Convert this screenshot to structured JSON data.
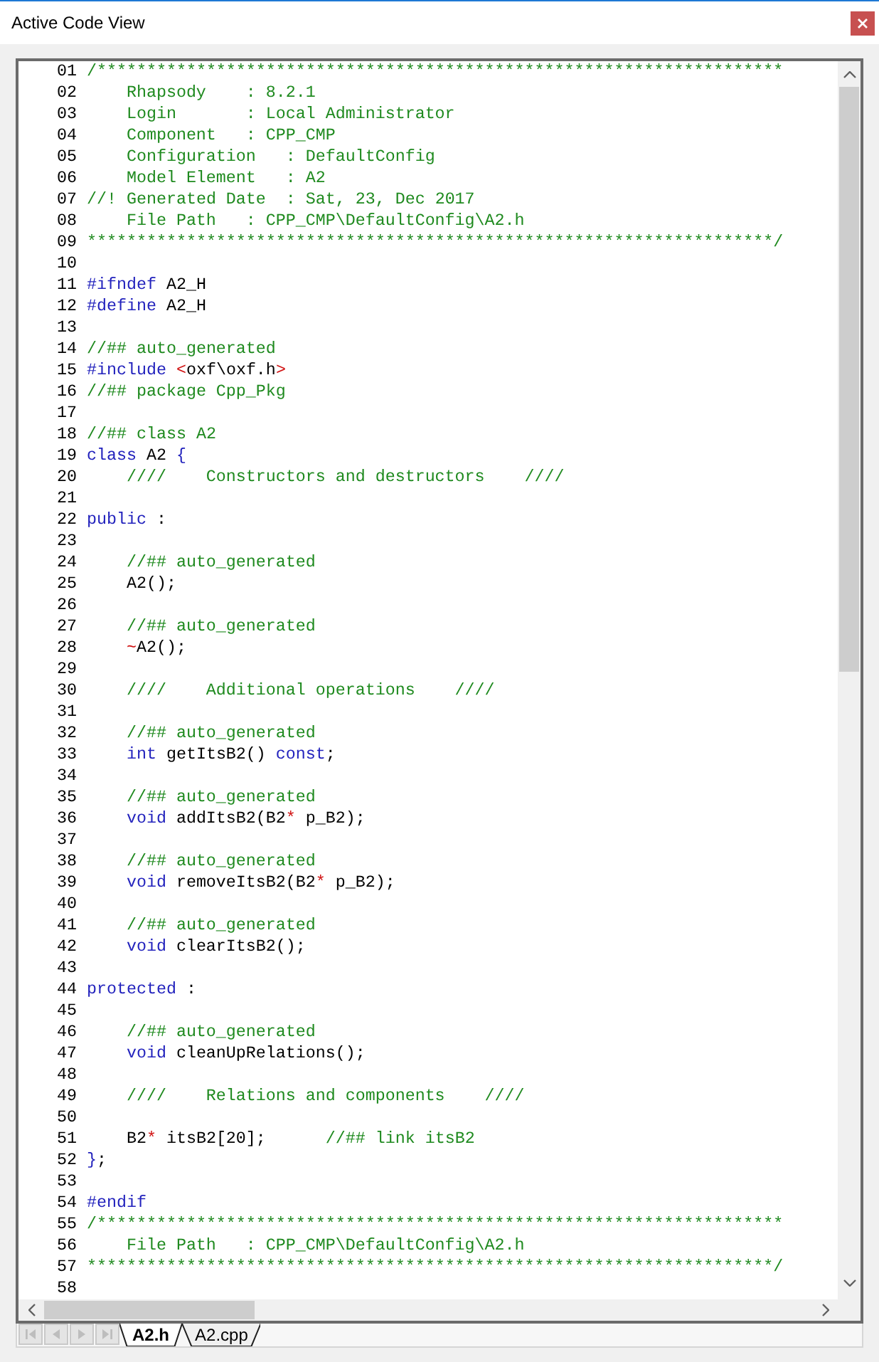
{
  "window": {
    "title": "Active Code View"
  },
  "editor": {
    "lines": [
      {
        "number": "01",
        "tokens": [
          {
            "kind": "comment",
            "text": "/*********************************************************************"
          }
        ]
      },
      {
        "number": "02",
        "tokens": [
          {
            "kind": "comment",
            "text": "    Rhapsody    : 8.2.1"
          }
        ]
      },
      {
        "number": "03",
        "tokens": [
          {
            "kind": "comment",
            "text": "    Login       : Local Administrator"
          }
        ]
      },
      {
        "number": "04",
        "tokens": [
          {
            "kind": "comment",
            "text": "    Component   : CPP_CMP"
          }
        ]
      },
      {
        "number": "05",
        "tokens": [
          {
            "kind": "comment",
            "text": "    Configuration   : DefaultConfig"
          }
        ]
      },
      {
        "number": "06",
        "tokens": [
          {
            "kind": "comment",
            "text": "    Model Element   : A2"
          }
        ]
      },
      {
        "number": "07",
        "tokens": [
          {
            "kind": "comment",
            "text": "//! Generated Date  : Sat, 23, Dec 2017"
          }
        ]
      },
      {
        "number": "08",
        "tokens": [
          {
            "kind": "comment",
            "text": "    File Path   : CPP_CMP\\DefaultConfig\\A2.h"
          }
        ]
      },
      {
        "number": "09",
        "tokens": [
          {
            "kind": "comment",
            "text": "*********************************************************************/"
          }
        ]
      },
      {
        "number": "10"
      },
      {
        "number": "11",
        "tokens": [
          {
            "kind": "keyword",
            "text": "#ifndef"
          },
          {
            "kind": "plain",
            "text": " A2_H"
          }
        ]
      },
      {
        "number": "12",
        "tokens": [
          {
            "kind": "keyword",
            "text": "#define"
          },
          {
            "kind": "plain",
            "text": " A2_H"
          }
        ]
      },
      {
        "number": "13"
      },
      {
        "number": "14",
        "tokens": [
          {
            "kind": "comment",
            "text": "//## auto_generated"
          }
        ]
      },
      {
        "number": "15",
        "tokens": [
          {
            "kind": "keyword",
            "text": "#include "
          },
          {
            "kind": "operator",
            "text": "<"
          },
          {
            "kind": "plain",
            "text": "oxf\\oxf.h"
          },
          {
            "kind": "operator",
            "text": ">"
          }
        ]
      },
      {
        "number": "16",
        "tokens": [
          {
            "kind": "comment",
            "text": "//## package Cpp_Pkg"
          }
        ]
      },
      {
        "number": "17"
      },
      {
        "number": "18",
        "tokens": [
          {
            "kind": "comment",
            "text": "//## class A2"
          }
        ]
      },
      {
        "number": "19",
        "tokens": [
          {
            "kind": "keyword",
            "text": "class"
          },
          {
            "kind": "plain",
            "text": " A2 "
          },
          {
            "kind": "keyword",
            "text": "{"
          }
        ]
      },
      {
        "number": "20",
        "tokens": [
          {
            "kind": "comment",
            "text": "    ////    Constructors and destructors    ////"
          }
        ]
      },
      {
        "number": "21"
      },
      {
        "number": "22",
        "tokens": [
          {
            "kind": "keyword",
            "text": "public"
          },
          {
            "kind": "plain",
            "text": " :"
          }
        ]
      },
      {
        "number": "23"
      },
      {
        "number": "24",
        "tokens": [
          {
            "kind": "comment",
            "text": "    //## auto_generated"
          }
        ]
      },
      {
        "number": "25",
        "tokens": [
          {
            "kind": "plain",
            "text": "    A2();"
          }
        ]
      },
      {
        "number": "26"
      },
      {
        "number": "27",
        "tokens": [
          {
            "kind": "comment",
            "text": "    //## auto_generated"
          }
        ]
      },
      {
        "number": "28",
        "tokens": [
          {
            "kind": "operator",
            "text": "    ~"
          },
          {
            "kind": "plain",
            "text": "A2();"
          }
        ]
      },
      {
        "number": "29"
      },
      {
        "number": "30",
        "tokens": [
          {
            "kind": "comment",
            "text": "    ////    Additional operations    ////"
          }
        ]
      },
      {
        "number": "31"
      },
      {
        "number": "32",
        "tokens": [
          {
            "kind": "comment",
            "text": "    //## auto_generated"
          }
        ]
      },
      {
        "number": "33",
        "tokens": [
          {
            "kind": "keyword",
            "text": "    int"
          },
          {
            "kind": "plain",
            "text": " getItsB2() "
          },
          {
            "kind": "keyword",
            "text": "const"
          },
          {
            "kind": "plain",
            "text": ";"
          }
        ]
      },
      {
        "number": "34"
      },
      {
        "number": "35",
        "tokens": [
          {
            "kind": "comment",
            "text": "    //## auto_generated"
          }
        ]
      },
      {
        "number": "36",
        "tokens": [
          {
            "kind": "keyword",
            "text": "    void"
          },
          {
            "kind": "plain",
            "text": " addItsB2(B2"
          },
          {
            "kind": "operator",
            "text": "*"
          },
          {
            "kind": "plain",
            "text": " p_B2);"
          }
        ]
      },
      {
        "number": "37"
      },
      {
        "number": "38",
        "tokens": [
          {
            "kind": "comment",
            "text": "    //## auto_generated"
          }
        ]
      },
      {
        "number": "39",
        "tokens": [
          {
            "kind": "keyword",
            "text": "    void"
          },
          {
            "kind": "plain",
            "text": " removeItsB2(B2"
          },
          {
            "kind": "operator",
            "text": "*"
          },
          {
            "kind": "plain",
            "text": " p_B2);"
          }
        ]
      },
      {
        "number": "40"
      },
      {
        "number": "41",
        "tokens": [
          {
            "kind": "comment",
            "text": "    //## auto_generated"
          }
        ]
      },
      {
        "number": "42",
        "tokens": [
          {
            "kind": "keyword",
            "text": "    void"
          },
          {
            "kind": "plain",
            "text": " clearItsB2();"
          }
        ]
      },
      {
        "number": "43"
      },
      {
        "number": "44",
        "tokens": [
          {
            "kind": "keyword",
            "text": "protected"
          },
          {
            "kind": "plain",
            "text": " :"
          }
        ]
      },
      {
        "number": "45"
      },
      {
        "number": "46",
        "tokens": [
          {
            "kind": "comment",
            "text": "    //## auto_generated"
          }
        ]
      },
      {
        "number": "47",
        "tokens": [
          {
            "kind": "keyword",
            "text": "    void"
          },
          {
            "kind": "plain",
            "text": " cleanUpRelations();"
          }
        ]
      },
      {
        "number": "48"
      },
      {
        "number": "49",
        "tokens": [
          {
            "kind": "comment",
            "text": "    ////    Relations and components    ////"
          }
        ]
      },
      {
        "number": "50"
      },
      {
        "number": "51",
        "tokens": [
          {
            "kind": "plain",
            "text": "    B2"
          },
          {
            "kind": "operator",
            "text": "*"
          },
          {
            "kind": "plain",
            "text": " itsB2[20];      "
          },
          {
            "kind": "comment",
            "text": "//## link itsB2"
          }
        ]
      },
      {
        "number": "52",
        "tokens": [
          {
            "kind": "keyword",
            "text": "}"
          },
          {
            "kind": "plain",
            "text": ";"
          }
        ]
      },
      {
        "number": "53"
      },
      {
        "number": "54",
        "tokens": [
          {
            "kind": "keyword",
            "text": "#endif"
          }
        ]
      },
      {
        "number": "55",
        "tokens": [
          {
            "kind": "comment",
            "text": "/*********************************************************************"
          }
        ]
      },
      {
        "number": "56",
        "tokens": [
          {
            "kind": "comment",
            "text": "    File Path   : CPP_CMP\\DefaultConfig\\A2.h"
          }
        ]
      },
      {
        "number": "57",
        "tokens": [
          {
            "kind": "comment",
            "text": "*********************************************************************/"
          }
        ]
      },
      {
        "number": "58"
      }
    ]
  },
  "tab_navigation": [
    {
      "kind": "first",
      "disabled": true
    },
    {
      "kind": "previous",
      "disabled": true
    },
    {
      "kind": "next",
      "disabled": true
    },
    {
      "kind": "last",
      "disabled": true
    }
  ],
  "tabs": [
    {
      "label": "A2.h",
      "selected": true
    },
    {
      "label": "A2.cpp",
      "selected": false
    }
  ]
}
